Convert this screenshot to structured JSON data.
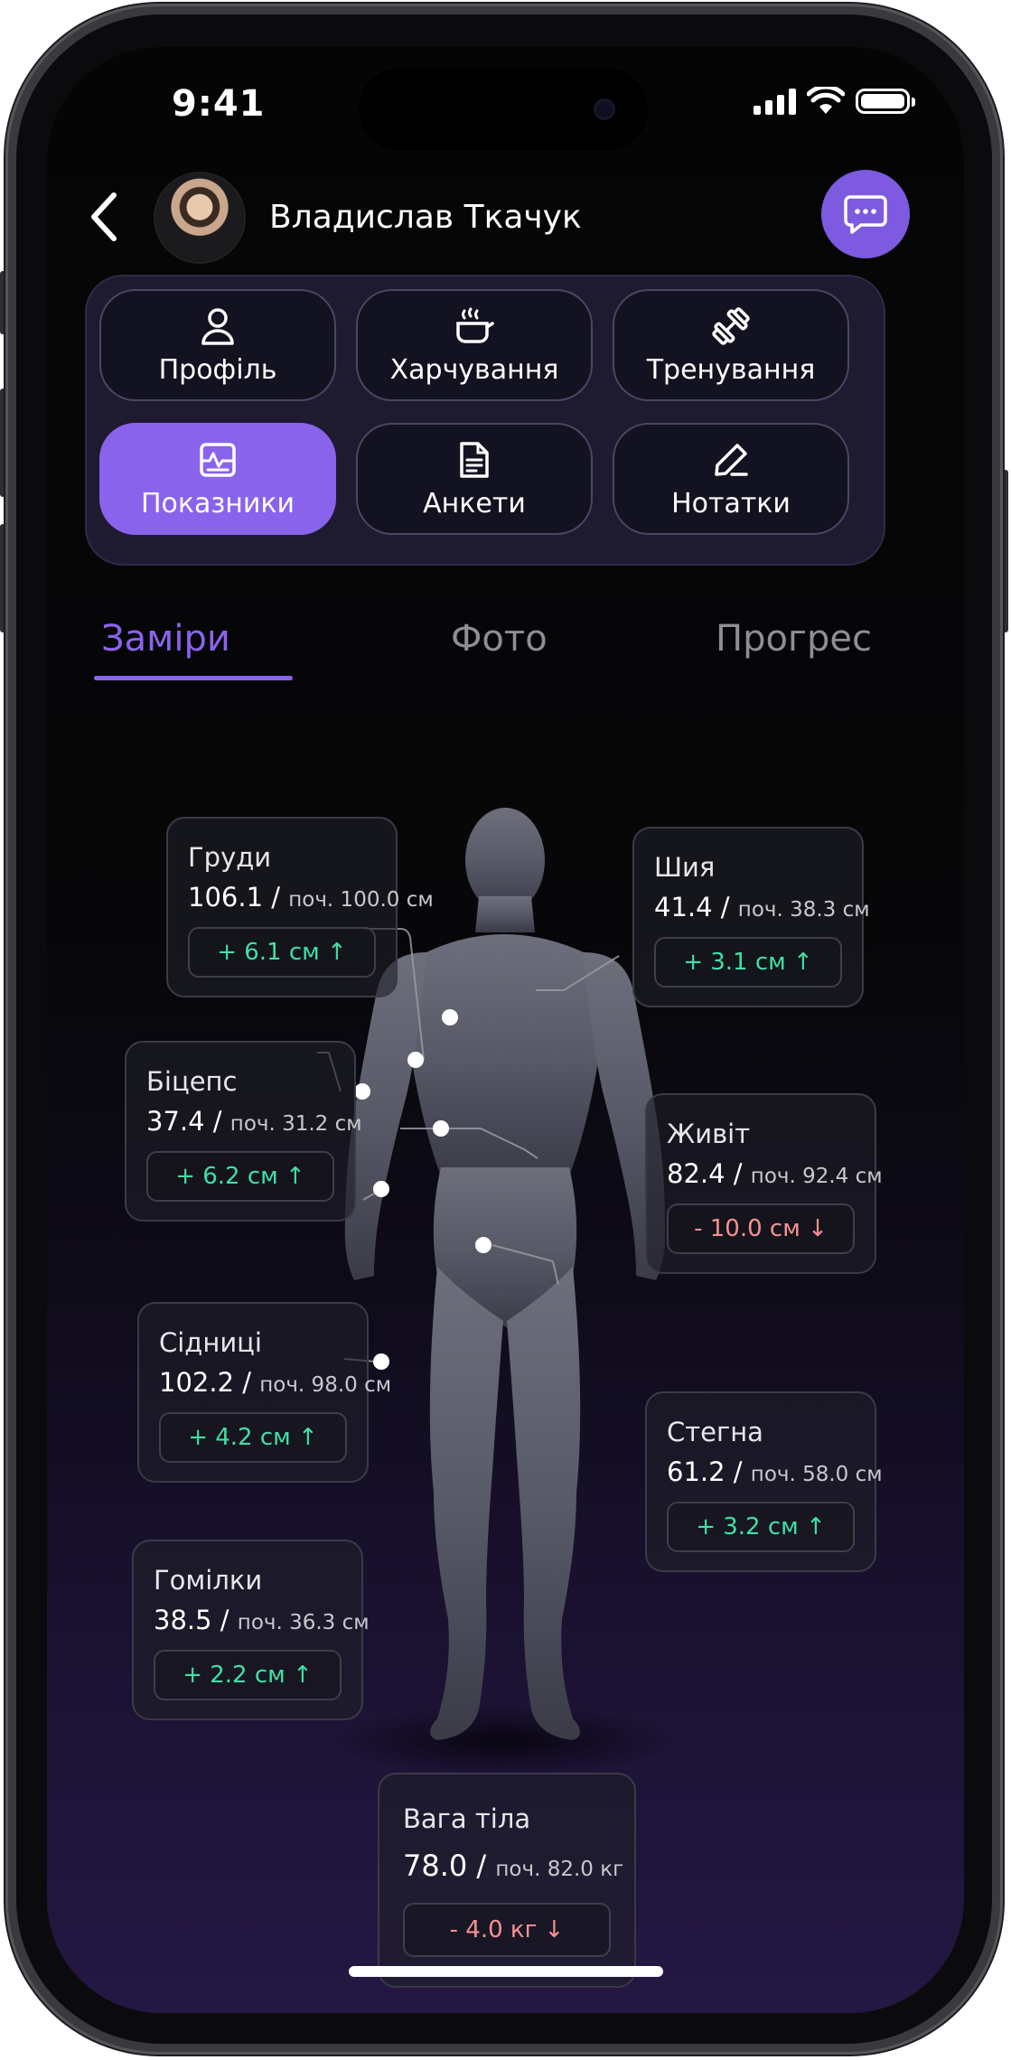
{
  "status": {
    "time": "9:41"
  },
  "header": {
    "user_name": "Владислав Ткачук"
  },
  "menu": {
    "items": [
      {
        "label": "Профіль",
        "icon": "user-icon"
      },
      {
        "label": "Харчування",
        "icon": "cooking-pot-icon"
      },
      {
        "label": "Тренування",
        "icon": "dumbbell-icon"
      },
      {
        "label": "Показники",
        "icon": "metrics-icon",
        "active": true
      },
      {
        "label": "Анкети",
        "icon": "document-icon"
      },
      {
        "label": "Нотатки",
        "icon": "pencil-icon"
      }
    ]
  },
  "tabs": [
    {
      "label": "Заміри",
      "active": true
    },
    {
      "label": "Фото"
    },
    {
      "label": "Прогрес"
    }
  ],
  "measurements": [
    {
      "key": "chest",
      "title": "Груди",
      "value": "106.1 /",
      "start": "поч. 100.0 см",
      "delta": "+ 6.1 см ↑",
      "trend": "up"
    },
    {
      "key": "neck",
      "title": "Шия",
      "value": "41.4 /",
      "start": "поч. 38.3 см",
      "delta": "+ 3.1 см ↑",
      "trend": "up"
    },
    {
      "key": "biceps",
      "title": "Біцепс",
      "value": "37.4 /",
      "start": "поч. 31.2 см",
      "delta": "+ 6.2 см ↑",
      "trend": "up"
    },
    {
      "key": "belly",
      "title": "Живіт",
      "value": "82.4 /",
      "start": "поч. 92.4 см",
      "delta": "- 10.0 см ↓",
      "trend": "down"
    },
    {
      "key": "glutes",
      "title": "Сідниці",
      "value": "102.2 /",
      "start": "поч. 98.0 см",
      "delta": "+ 4.2 см ↑",
      "trend": "up"
    },
    {
      "key": "thighs",
      "title": "Стегна",
      "value": "61.2 /",
      "start": "поч. 58.0 см",
      "delta": "+ 3.2 см ↑",
      "trend": "up"
    },
    {
      "key": "calves",
      "title": "Гомілки",
      "value": "38.5 /",
      "start": "поч. 36.3 см",
      "delta": "+ 2.2 см ↑",
      "trend": "up"
    },
    {
      "key": "weight",
      "title": "Вага тіла",
      "value": "78.0 /",
      "start": "поч. 82.0 кг",
      "delta": "- 4.0 кг ↓",
      "trend": "down"
    }
  ],
  "colors": {
    "accent": "#8a63ec",
    "up": "#3fe0a4",
    "down": "#f59292"
  }
}
